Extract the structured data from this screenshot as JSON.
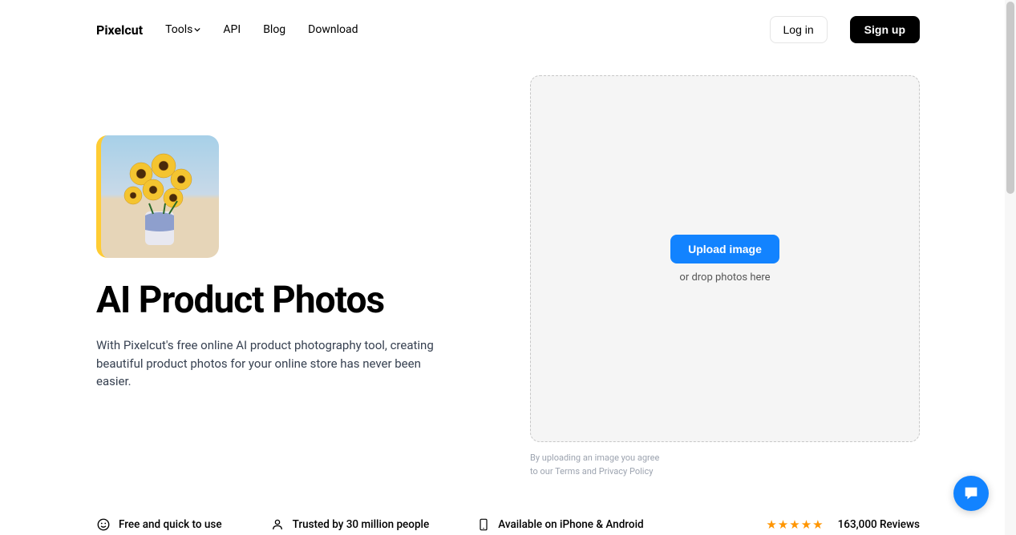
{
  "nav": {
    "brand": "Pixelcut",
    "tools": "Tools",
    "api": "API",
    "blog": "Blog",
    "download": "Download",
    "login": "Log in",
    "signup": "Sign up"
  },
  "hero": {
    "heading": "AI Product Photos",
    "desc": "With Pixelcut's free online AI product photography tool, creating beautiful product photos for your online store has never been easier."
  },
  "upload": {
    "button": "Upload image",
    "drop": "or drop photos here",
    "legal1": "By uploading an image you agree",
    "legal2_prefix": "to our ",
    "terms": "Terms",
    "and": " and ",
    "privacy": "Privacy Policy"
  },
  "features": {
    "f1": "Free and quick to use",
    "f2": "Trusted by 30 million people",
    "f3": "Available on iPhone & Android",
    "reviews": "163,000 Reviews"
  }
}
